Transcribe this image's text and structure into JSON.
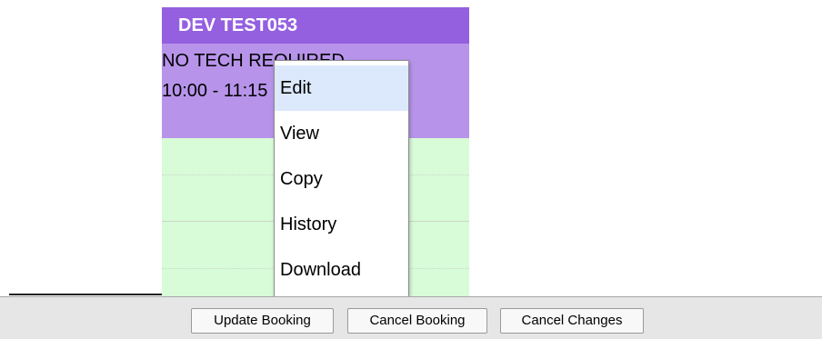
{
  "booking": {
    "title": "DEV TEST053",
    "tech_line": "NO TECH REQUIRED",
    "time_line": "10:00 - 11:15"
  },
  "context_menu": {
    "items": [
      {
        "label": "Edit",
        "active": true
      },
      {
        "label": "View",
        "active": false
      },
      {
        "label": "Copy",
        "active": false
      },
      {
        "label": "History",
        "active": false
      },
      {
        "label": "Download",
        "active": false
      }
    ]
  },
  "toolbar": {
    "update_label": "Update Booking",
    "cancel_booking_label": "Cancel Booking",
    "cancel_changes_label": "Cancel Changes"
  },
  "colors": {
    "booking_header": "#9460e0",
    "booking_body": "#b794ea",
    "free_slot": "#d8fbd8",
    "menu_highlight": "#dce9fd",
    "toolbar_background": "#e6e6e6"
  }
}
